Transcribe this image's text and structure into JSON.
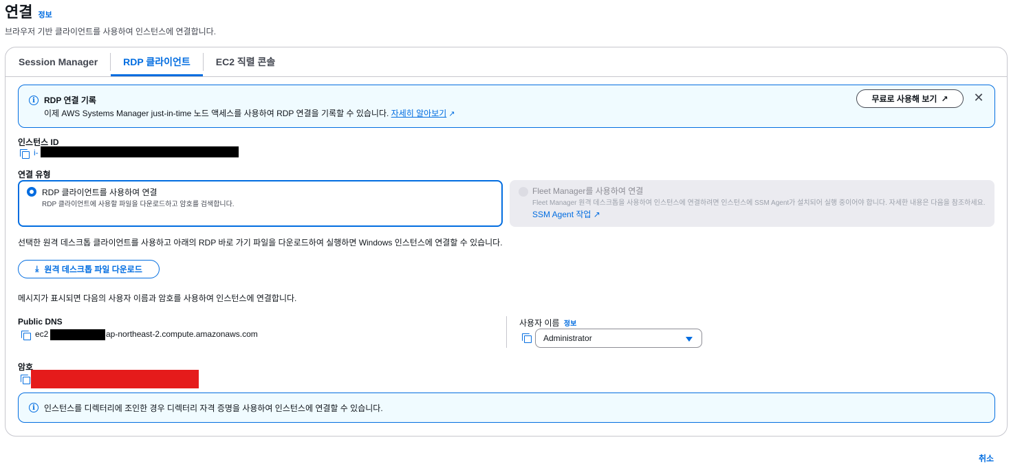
{
  "header": {
    "title": "연결",
    "info": "정보",
    "description": "브라우저 기반 클라이언트를 사용하여 인스턴스에 연결합니다."
  },
  "tabs": [
    {
      "label": "Session Manager",
      "active": false
    },
    {
      "label": "RDP 클라이언트",
      "active": true
    },
    {
      "label": "EC2 직렬 콘솔",
      "active": false
    }
  ],
  "flash_rdp": {
    "title": "RDP 연결 기록",
    "body": "이제 AWS Systems Manager just-in-time 노드 액세스를 사용하여 RDP 연결을 기록할 수 있습니다.",
    "link": "자세히 알아보기",
    "button": "무료로 사용해 보기"
  },
  "instance": {
    "label": "인스턴스 ID",
    "prefix": "i-"
  },
  "connection_type": {
    "label": "연결 유형",
    "options": [
      {
        "title": "RDP 클라이언트를 사용하여 연결",
        "description": "RDP 클라이언트에 사용할 파일을 다운로드하고 암호를 검색합니다.",
        "selected": true
      },
      {
        "title": "Fleet Manager를 사용하여 연결",
        "description": "Fleet Manager 원격 데스크톱을 사용하여 인스턴스에 연결하려면 인스턴스에 SSM Agent가 설치되어 실행 중이어야 합니다. 자세한 내용은 다음을 참조하세요.",
        "link": "SSM Agent 작업",
        "selected": false
      }
    ]
  },
  "rdp_instructions": "선택한 원격 데스크톱 클라이언트를 사용하고 아래의 RDP 바로 가기 파일을 다운로드하여 실행하면 Windows 인스턴스에 연결할 수 있습니다.",
  "download_button": "원격 데스크톱 파일 다운로드",
  "credentials_instructions": "메시지가 표시되면 다음의 사용자 이름과 암호를 사용하여 인스턴스에 연결합니다.",
  "public_dns": {
    "label": "Public DNS",
    "prefix": "ec2",
    "suffix": "ap-northeast-2.compute.amazonaws.com"
  },
  "username": {
    "label": "사용자 이름",
    "info": "정보",
    "value": "Administrator"
  },
  "password": {
    "label": "암호"
  },
  "flash_directory": {
    "body": "인스턴스를 디렉터리에 조인한 경우 디렉터리 자격 증명을 사용하여 인스턴스에 연결할 수 있습니다."
  },
  "footer": {
    "cancel": "취소"
  },
  "colors": {
    "accent": "#006ce0",
    "info_background": "#f0fbff",
    "disabled_tile": "#ebebf0",
    "redaction": "#000000",
    "password_redaction": "#e51b1b"
  }
}
